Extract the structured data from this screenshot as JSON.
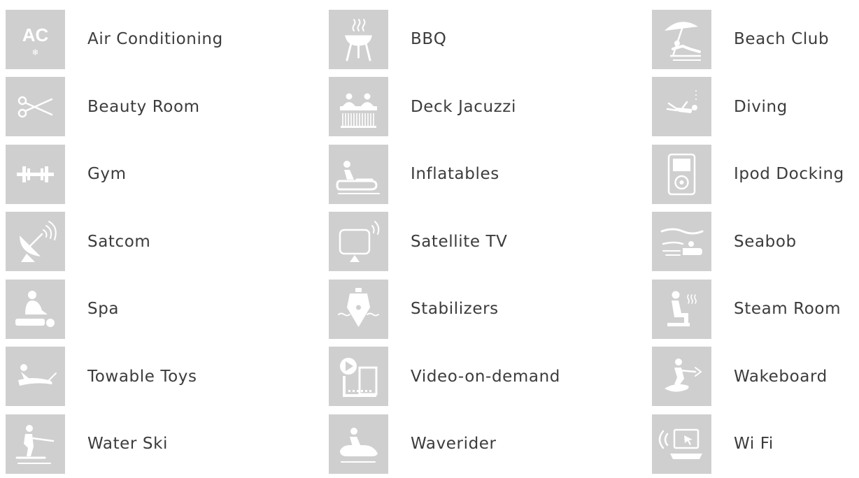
{
  "amenities": [
    {
      "label": "Air Conditioning",
      "icon": "air-conditioning-icon"
    },
    {
      "label": "BBQ",
      "icon": "bbq-icon"
    },
    {
      "label": "Beach Club",
      "icon": "beach-club-icon"
    },
    {
      "label": "Beauty Room",
      "icon": "scissors-icon"
    },
    {
      "label": "Deck Jacuzzi",
      "icon": "jacuzzi-icon"
    },
    {
      "label": "Diving",
      "icon": "diver-icon"
    },
    {
      "label": "Gym",
      "icon": "dumbbell-icon"
    },
    {
      "label": "Inflatables",
      "icon": "inflatable-icon"
    },
    {
      "label": "Ipod Docking",
      "icon": "ipod-icon"
    },
    {
      "label": "Satcom",
      "icon": "satellite-dish-icon"
    },
    {
      "label": "Satellite TV",
      "icon": "satellite-tv-icon"
    },
    {
      "label": "Seabob",
      "icon": "seabob-icon"
    },
    {
      "label": "Spa",
      "icon": "massage-icon"
    },
    {
      "label": "Stabilizers",
      "icon": "boat-stabilizer-icon"
    },
    {
      "label": "Steam Room",
      "icon": "steam-room-icon"
    },
    {
      "label": "Towable Toys",
      "icon": "towable-toy-icon"
    },
    {
      "label": "Video-on-demand",
      "icon": "video-film-icon"
    },
    {
      "label": "Wakeboard",
      "icon": "wakeboarder-icon"
    },
    {
      "label": "Water Ski",
      "icon": "water-skier-icon"
    },
    {
      "label": "Waverider",
      "icon": "jet-ski-icon"
    },
    {
      "label": "Wi Fi",
      "icon": "wifi-laptop-icon"
    }
  ],
  "icon_glyphs": {
    "air-conditioning": {
      "text": "AC",
      "sub": "❄"
    }
  },
  "colors": {
    "tile_background": "#cfcfcf",
    "icon_foreground": "#ffffff",
    "label_text": "#3c3c3c"
  }
}
